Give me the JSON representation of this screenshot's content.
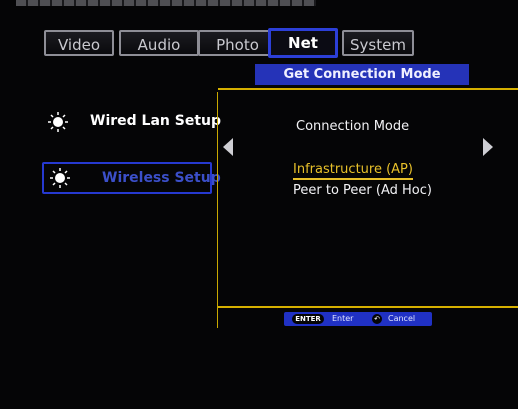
{
  "tabs": [
    {
      "label": "Video",
      "active": false
    },
    {
      "label": "Audio",
      "active": false
    },
    {
      "label": "Photo",
      "active": false
    },
    {
      "label": "Net",
      "active": true
    },
    {
      "label": "System",
      "active": false
    }
  ],
  "header": {
    "title": "Get Connection Mode"
  },
  "menu": [
    {
      "label": "Wired Lan Setup",
      "selected": false,
      "icon": "sun-icon"
    },
    {
      "label": "Wireless Setup",
      "selected": true,
      "icon": "sun-icon"
    }
  ],
  "panel": {
    "label": "Connection Mode",
    "options": [
      {
        "label": "Infrastructure (AP)",
        "selected": true
      },
      {
        "label": "Peer to Peer (Ad Hoc)",
        "selected": false
      }
    ]
  },
  "hints": {
    "enter_key": "ENTER",
    "enter_label": "Enter",
    "cancel_label": "Cancel",
    "cancel_icon": "return-icon"
  },
  "colors": {
    "accent": "#2533b8",
    "highlight": "#e8c12a",
    "divider": "#d6b000"
  }
}
